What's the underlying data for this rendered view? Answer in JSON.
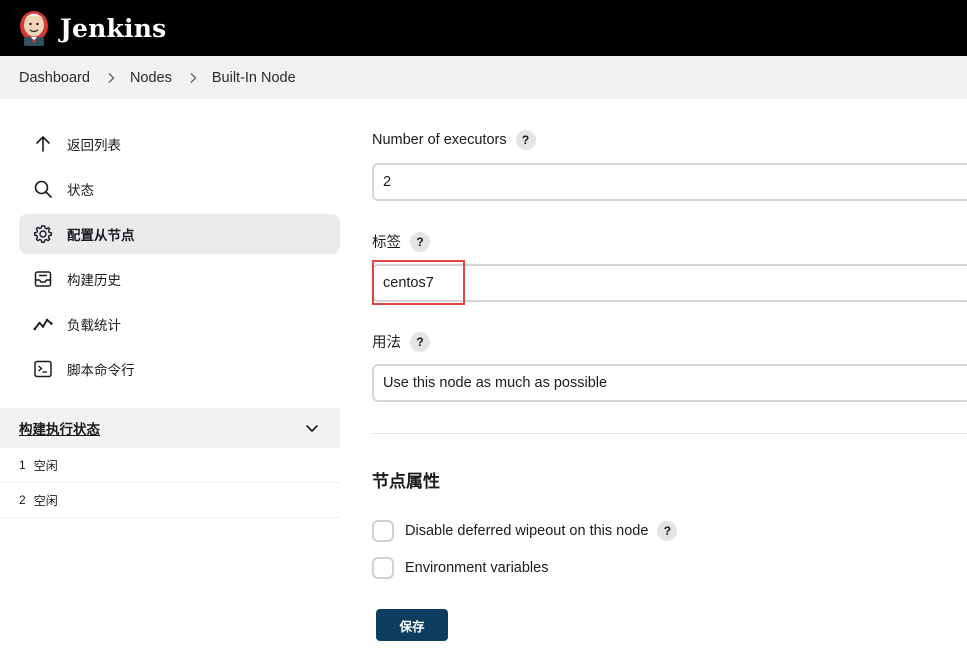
{
  "header": {
    "brand": "Jenkins",
    "logo_icon": "jenkins-butler-logo-icon"
  },
  "breadcrumb": {
    "items": [
      "Dashboard",
      "Nodes",
      "Built-In Node"
    ]
  },
  "sidebar": {
    "tasks": [
      {
        "label": "返回列表",
        "icon": "arrow-up-icon"
      },
      {
        "label": "状态",
        "icon": "search-icon"
      },
      {
        "label": "配置从节点",
        "icon": "gear-icon",
        "active": true
      },
      {
        "label": "构建历史",
        "icon": "inbox-icon"
      },
      {
        "label": "负载统计",
        "icon": "trend-line-icon"
      },
      {
        "label": "脚本命令行",
        "icon": "terminal-icon"
      }
    ],
    "executors": {
      "title": "构建执行状态",
      "rows": [
        {
          "number": "1",
          "status": "空闲"
        },
        {
          "number": "2",
          "status": "空闲"
        }
      ]
    }
  },
  "form": {
    "executors_label": "Number of executors",
    "executors_value": "2",
    "labels_label": "标签",
    "labels_value": "centos7",
    "usage_label": "用法",
    "usage_value": "Use this node as much as possible",
    "help_glyph": "?",
    "node_properties_title": "节点属性",
    "properties": [
      {
        "label": "Disable deferred wipeout on this node",
        "has_help": true,
        "checked": false
      },
      {
        "label": "Environment variables",
        "has_help": false,
        "checked": false
      }
    ],
    "save_label": "保存"
  },
  "colors": {
    "header_bg": "#000000",
    "breadcrumb_bg": "#f2f2f3",
    "active_task_bg": "#ebebee",
    "highlight_border": "#e04546",
    "save_button_bg": "#0c3c5e"
  }
}
